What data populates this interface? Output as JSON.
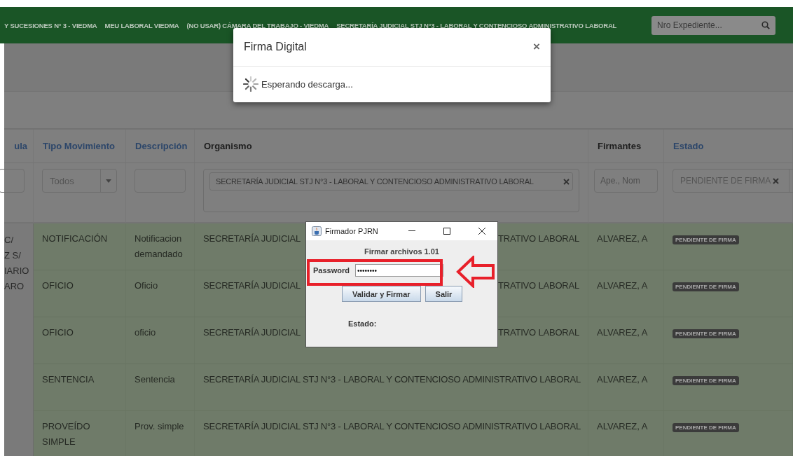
{
  "nav": {
    "items": [
      "Y SUCESIONES N° 3 - VIEDMA",
      "MEU LABORAL VIEDMA",
      "(NO USAR) CÁMARA DEL TRABAJO - VIEDMA",
      "SECRETARÍA JUDICIAL STJ N°3 - LABORAL Y CONTENCIOSO ADMINISTRATIVO LABORAL"
    ],
    "search": {
      "placeholder": "Nro Expediente..."
    }
  },
  "table": {
    "columns": [
      {
        "label": "ula",
        "sortable": true
      },
      {
        "label": "Tipo Movimiento",
        "sortable": true
      },
      {
        "label": "Descripción",
        "sortable": true
      },
      {
        "label": "Organismo",
        "sortable": false
      },
      {
        "label": "Firmantes",
        "sortable": false
      },
      {
        "label": "Estado",
        "sortable": true
      }
    ],
    "filters": {
      "tipo": "Todos",
      "organismo_tag": "SECRETARÍA JUDICIAL STJ N°3 - LABORAL Y CONTENCIOSO ADMINISTRATIVO LABORAL",
      "firmantes_placeholder": "Ape., Nom",
      "estado": "PENDIENTE DE FIRMA"
    },
    "caratula_lines": [
      "C/",
      "Z S/",
      "IARIO",
      "ARO"
    ],
    "rows": [
      {
        "tipo": "NOTIFICACIÓN",
        "descripcion": "Notificacion demandado",
        "organismo_left": "SECRETARÍA JUDICIAL",
        "organismo_right": "TRATIVO LABORAL",
        "firmantes": "ALVAREZ, A",
        "estado": "PENDIENTE DE FIRMA"
      },
      {
        "tipo": "OFICIO",
        "descripcion": "Oficio",
        "organismo_left": "SECRETARÍA JUDICIAL",
        "organismo_right": "TRATIVO LABORAL",
        "firmantes": "ALVAREZ, A",
        "estado": "PENDIENTE DE FIRMA"
      },
      {
        "tipo": "OFICIO",
        "descripcion": "oficio",
        "organismo_left": "SECRETARÍA JUDICIAL",
        "organismo_right": "TRATIVO LABORAL",
        "firmantes": "ALVAREZ, A",
        "estado": "PENDIENTE DE FIRMA"
      },
      {
        "tipo": "SENTENCIA",
        "descripcion": "Sentencia",
        "organismo": "SECRETARÍA JUDICIAL STJ N°3 - LABORAL Y CONTENCIOSO ADMINISTRATIVO LABORAL",
        "firmantes": "ALVAREZ, A",
        "estado": "PENDIENTE DE FIRMA"
      },
      {
        "tipo": "PROVEÍDO SIMPLE",
        "descripcion": "Prov. simple",
        "organismo": "SECRETARÍA JUDICIAL STJ N°3 - LABORAL Y CONTENCIOSO ADMINISTRATIVO LABORAL",
        "firmantes": "ALVAREZ, A",
        "estado": "PENDIENTE DE FIRMA"
      }
    ]
  },
  "modal": {
    "title": "Firma Digital",
    "close": "×",
    "message": "Esperando descarga..."
  },
  "signer": {
    "title": "Firmador PJRN",
    "heading": "Firmar archivos 1.01",
    "password_label": "Password",
    "password_value": "••••••••",
    "buttons": [
      "Validar y Firmar",
      "Salir"
    ],
    "status_label": "Estado:"
  }
}
